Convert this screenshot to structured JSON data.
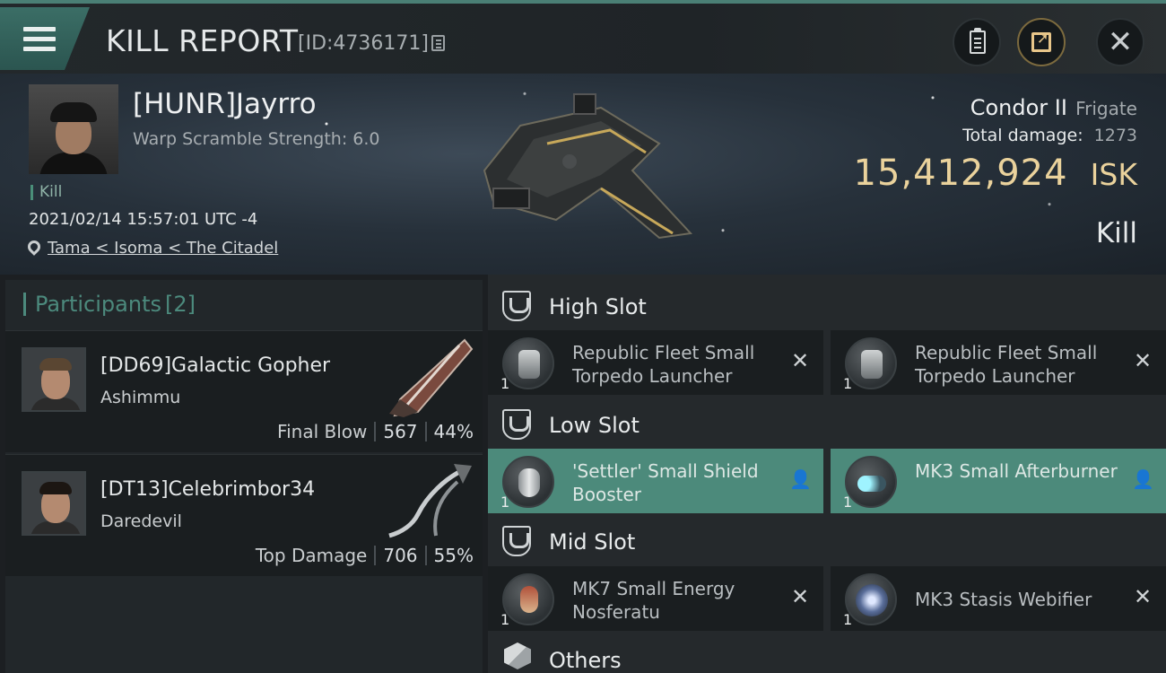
{
  "topbar": {
    "title": "KILL REPORT",
    "report_id": "[ID:4736171]",
    "icons": [
      "menu-icon",
      "copy-icon",
      "clipboard-icon",
      "share-icon",
      "close-icon"
    ]
  },
  "victim": {
    "name": "[HUNR]Jayrro",
    "warp_scramble": "Warp Scramble Strength: 6.0",
    "kill_tag": "Kill",
    "datetime": "2021/02/14 15:57:01 UTC -4",
    "location": "Tama < Isoma < The Citadel",
    "ship_name": "Condor II",
    "ship_class": "Frigate",
    "total_damage_label": "Total damage:",
    "total_damage": "1273",
    "isk_value": "15,412,924",
    "isk_unit": "ISK",
    "result": "Kill"
  },
  "participants": {
    "title": "Participants",
    "count": "[2]",
    "list": [
      {
        "name": "[DD69]Galactic Gopher",
        "ship": "Ashimmu",
        "role": "Final Blow",
        "damage": "567",
        "percent": "44%"
      },
      {
        "name": "[DT13]Celebrimbor34",
        "ship": "Daredevil",
        "role": "Top Damage",
        "damage": "706",
        "percent": "55%"
      }
    ]
  },
  "fitting": {
    "high": {
      "title": "High Slot",
      "modules": [
        {
          "name": "Republic Fleet Small Torpedo Launcher",
          "qty": "1",
          "state": "destroyed",
          "status_icon": "✕"
        },
        {
          "name": "Republic Fleet Small Torpedo Launcher",
          "qty": "1",
          "state": "destroyed",
          "status_icon": "✕"
        }
      ]
    },
    "low": {
      "title": "Low Slot",
      "modules": [
        {
          "name": "'Settler' Small Shield Booster",
          "qty": "1",
          "state": "dropped",
          "status_icon": "👤"
        },
        {
          "name": "MK3 Small Afterburner",
          "qty": "1",
          "state": "dropped",
          "status_icon": "👤"
        }
      ]
    },
    "mid": {
      "title": "Mid Slot",
      "modules": [
        {
          "name": "MK7 Small Energy Nosferatu",
          "qty": "1",
          "state": "destroyed",
          "status_icon": "✕"
        },
        {
          "name": "MK3 Stasis Webifier",
          "qty": "1",
          "state": "destroyed",
          "status_icon": "✕"
        }
      ]
    },
    "others": {
      "title": "Others"
    }
  },
  "colors": {
    "accent": "#4c8a7b",
    "isk": "#ead29c",
    "background": "#1c1f22"
  }
}
